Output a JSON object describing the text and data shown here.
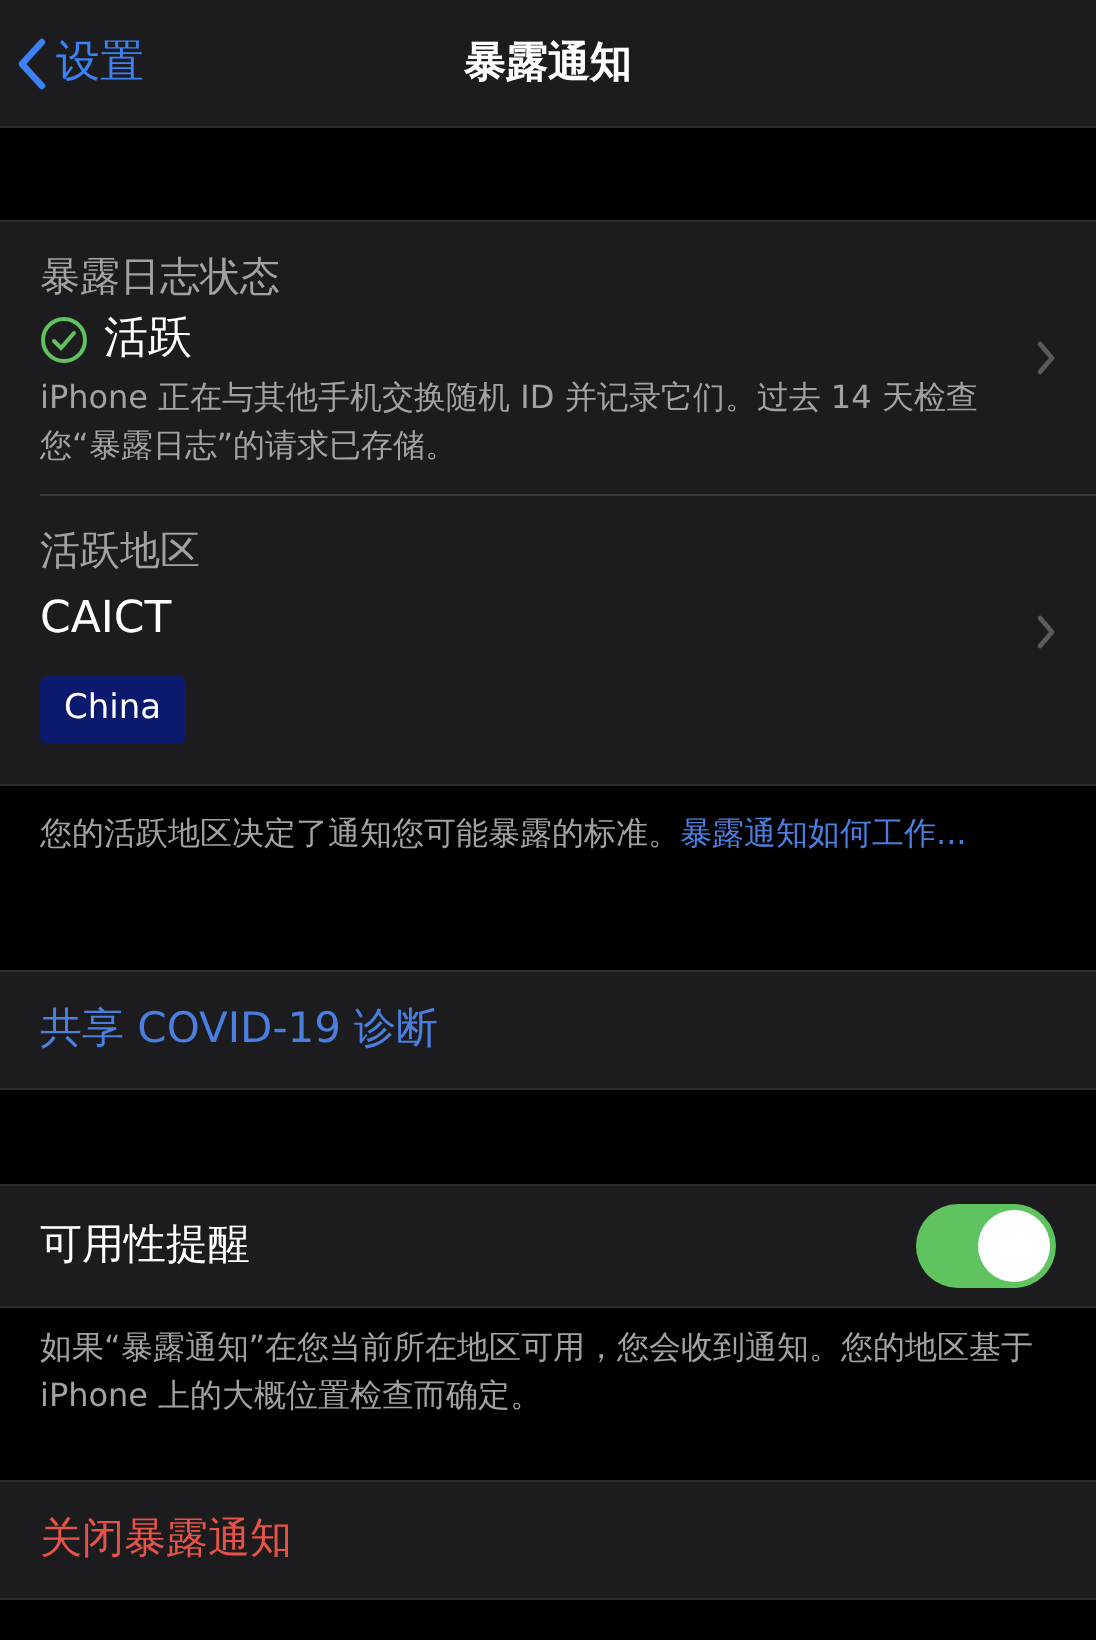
{
  "nav": {
    "back": "设置",
    "title": "暴露通知"
  },
  "status_section": {
    "rows": [
      {
        "kind": "status",
        "label": "暴露日志状态",
        "value": "活跃",
        "active": true,
        "description": "iPhone 正在与其他手机交换随机 ID 并记录它们。过去 14 天检查您“暴露日志”的请求已存储。"
      },
      {
        "kind": "region",
        "label": "活跃地区",
        "value": "CAICT",
        "tag": "China"
      }
    ],
    "footer": "您的活跃地区决定了通知您可能暴露的标准。",
    "footer_link": "暴露通知如何工作..."
  },
  "share": {
    "label": "共享 COVID-19 诊断"
  },
  "availability": {
    "label": "可用性提醒",
    "on": true,
    "footer": "如果“暴露通知”在您当前所在地区可用，您会收到通知。您的地区基于 iPhone 上的大概位置检查而确定。"
  },
  "turn_off": {
    "label": "关闭暴露通知"
  }
}
